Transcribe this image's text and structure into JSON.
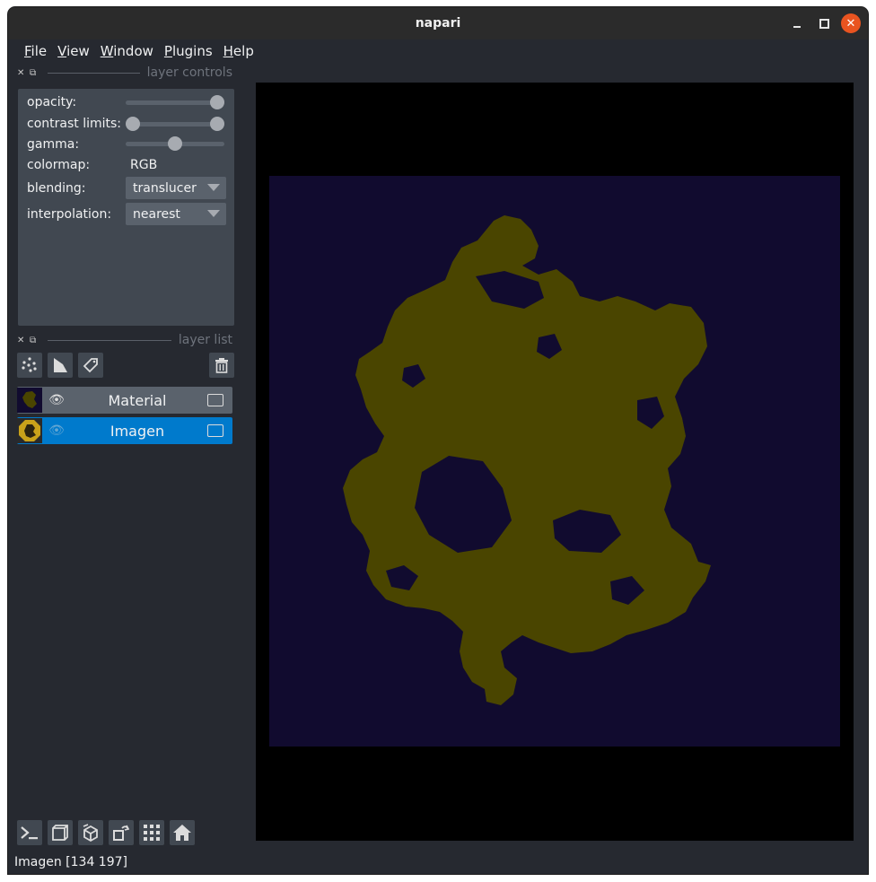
{
  "window": {
    "title": "napari"
  },
  "menu": {
    "items": [
      {
        "u": "F",
        "rest": "ile"
      },
      {
        "u": "V",
        "rest": "iew"
      },
      {
        "u": "W",
        "rest": "indow"
      },
      {
        "u": "P",
        "rest": "lugins"
      },
      {
        "u": "H",
        "rest": "elp"
      }
    ]
  },
  "layer_controls": {
    "header": "layer controls",
    "opacity_label": "opacity:",
    "opacity_value": 1.0,
    "contrast_label": "contrast limits:",
    "contrast_range": [
      0.0,
      1.0
    ],
    "gamma_label": "gamma:",
    "gamma_value": 0.5,
    "colormap_label": "colormap:",
    "colormap_value": "RGB",
    "blending_label": "blending:",
    "blending_value": "translucer",
    "interpolation_label": "interpolation:",
    "interpolation_value": "nearest"
  },
  "layer_list": {
    "header": "layer list",
    "layers": [
      {
        "name": "Material",
        "visible": true,
        "selected": false
      },
      {
        "name": "Imagen",
        "visible": false,
        "selected": true
      }
    ]
  },
  "status": {
    "text": "Imagen [134 197]"
  },
  "colors": {
    "background": "#262930",
    "panel": "#414851",
    "selected": "#007acc",
    "canvas": "#000000",
    "image_background": "#110b2f",
    "blob": "#4a4500"
  }
}
